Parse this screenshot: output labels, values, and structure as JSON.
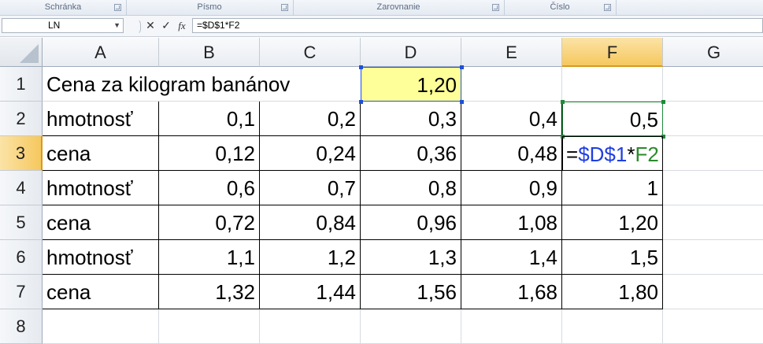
{
  "ribbon": {
    "groups": [
      {
        "label": "Schránka"
      },
      {
        "label": "Písmo"
      },
      {
        "label": "Zarovnanie"
      },
      {
        "label": "Číslo"
      }
    ]
  },
  "formula_bar": {
    "name_box": "LN",
    "cancel_symbol": "✕",
    "enter_symbol": "✓",
    "fx_symbol": "fx",
    "formula": "=$D$1*F2"
  },
  "columns": [
    "A",
    "B",
    "C",
    "D",
    "E",
    "F",
    "G"
  ],
  "rows": [
    "1",
    "2",
    "3",
    "4",
    "5",
    "6",
    "7",
    "8"
  ],
  "cells": {
    "A1": "Cena za kilogram banánov",
    "D1": "1,20",
    "A2": "hmotnosť",
    "B2": "0,1",
    "C2": "0,2",
    "D2": "0,3",
    "E2": "0,4",
    "F2": "0,5",
    "A3": "cena",
    "B3": "0,12",
    "C3": "0,24",
    "D3": "0,36",
    "E3": "0,48",
    "A4": "hmotnosť",
    "B4": "0,6",
    "C4": "0,7",
    "D4": "0,8",
    "E4": "0,9",
    "F4": "1",
    "A5": "cena",
    "B5": "0,72",
    "C5": "0,84",
    "D5": "0,96",
    "E5": "1,08",
    "F5": "1,20",
    "A6": "hmotnosť",
    "B6": "1,1",
    "C6": "1,2",
    "D6": "1,3",
    "E6": "1,4",
    "F6": "1,5",
    "A7": "cena",
    "B7": "1,32",
    "C7": "1,44",
    "D7": "1,56",
    "E7": "1,68",
    "F7": "1,80"
  },
  "edit_cell": {
    "ref": "F3",
    "eq": "=",
    "abs_ref": "$D$1",
    "op": "*",
    "rel_ref": "F2"
  },
  "colors": {
    "d1_fill": "#ffff99",
    "abs_ref_color": "#1f3fe0",
    "rel_ref_color": "#2a8a2a",
    "selected_header": "#f6c85e"
  }
}
